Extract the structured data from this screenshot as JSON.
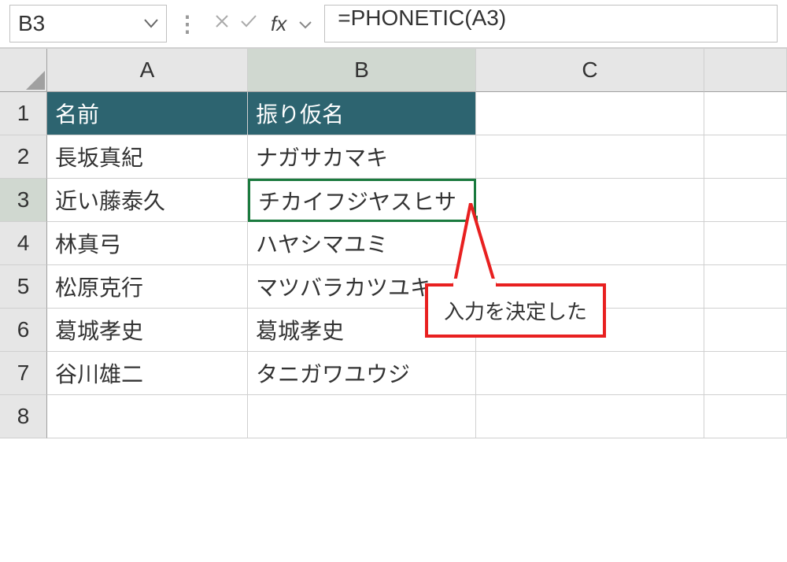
{
  "name_box": {
    "value": "B3"
  },
  "formula_bar": {
    "fx_label": "fx",
    "value": "=PHONETIC(A3)"
  },
  "columns": [
    "A",
    "B",
    "C"
  ],
  "rows": [
    "1",
    "2",
    "3",
    "4",
    "5",
    "6",
    "7",
    "8"
  ],
  "active_cell": {
    "row": 3,
    "col": "B"
  },
  "data": {
    "headers": {
      "A": "名前",
      "B": "振り仮名"
    },
    "cells": {
      "A2": "長坂真紀",
      "B2": "ナガサカマキ",
      "A3": "近い藤泰久",
      "B3": "チカイフジヤスヒサ",
      "A4": "林真弓",
      "B4": "ハヤシマユミ",
      "A5": "松原克行",
      "B5": "マツバラカツユキ",
      "A6": "葛城孝史",
      "B6": "葛城孝史",
      "A7": "谷川雄二",
      "B7": "タニガワユウジ"
    }
  },
  "callout": {
    "text": "入力を決定した"
  }
}
